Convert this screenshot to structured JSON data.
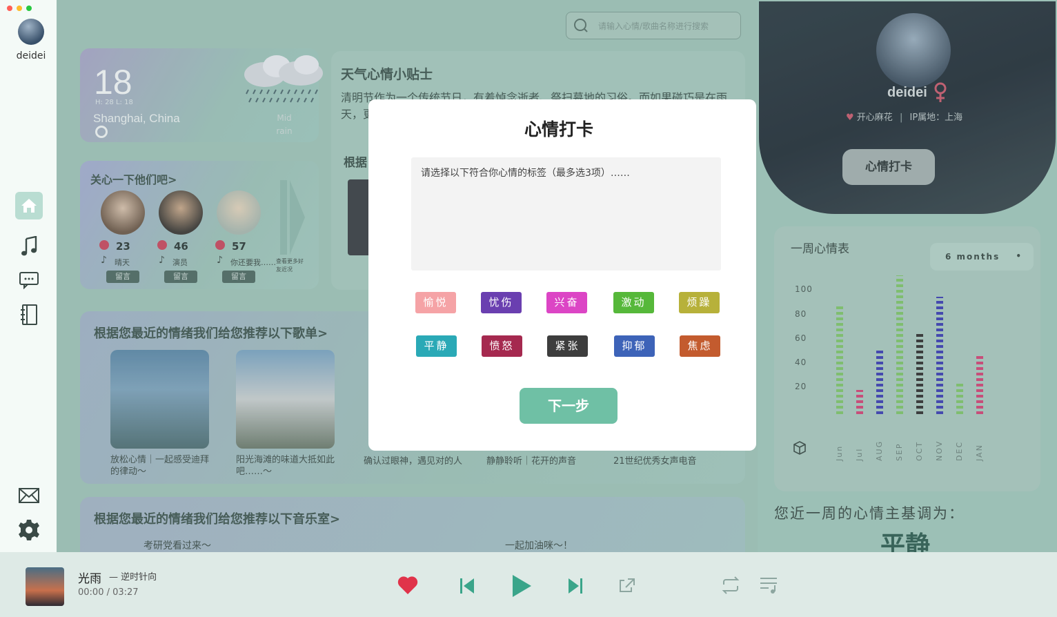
{
  "window": {
    "dot_colors": [
      "#ff5f57",
      "#febc2e",
      "#28c840"
    ]
  },
  "sidebar": {
    "username": "deidei",
    "nav": [
      "home-icon",
      "music-icon",
      "chat-icon",
      "notebook-icon",
      "mail-icon",
      "gear-icon"
    ]
  },
  "search": {
    "placeholder": "请输入心情/歌曲名称进行搜索"
  },
  "weather": {
    "temp": "18",
    "high_low": "H: 28   L: 18",
    "city": "Shanghai, China",
    "desc": "Mid rain"
  },
  "tips": {
    "title": "天气心情小贴士",
    "text": "清明节作为一个传统节日，有着悼念逝者、祭扫墓地的习俗。而如果碰巧是在雨天，更……奏、抒……",
    "sub": "根据"
  },
  "friends": {
    "title": "关心一下他们吧>",
    "items": [
      {
        "count": "23",
        "song": "晴天",
        "msg": "留言"
      },
      {
        "count": "46",
        "song": "演员",
        "msg": "留言"
      },
      {
        "count": "57",
        "song": "你还要我……",
        "msg": "留言"
      }
    ],
    "more": "查看更多好友近况"
  },
  "playlists": {
    "title": "根据您最近的情绪我们给您推荐以下歌单>",
    "items": [
      {
        "caption": "放松心情｜一起感受迪拜的律动～"
      },
      {
        "caption": "阳光海滩的味道大抵如此吧……～"
      },
      {
        "caption": "确认过眼神，遇见对的人"
      },
      {
        "caption": "静静聆听｜花开的声音"
      },
      {
        "caption": "21世纪优秀女声电音"
      }
    ]
  },
  "rooms": {
    "title": "根据您最近的情绪我们给您推荐以下音乐室>",
    "items": [
      "考研党看过来～",
      "一起加油咪～！"
    ]
  },
  "profile": {
    "name": "deidei",
    "gender_icon": "female-icon",
    "tag": "开心麻花",
    "location": "IP属地：上海",
    "checkin": "心情打卡"
  },
  "weekly": {
    "title": "一周心情表",
    "range": "6 months",
    "summary": "您近一周的心情主基调为：",
    "result": "平静"
  },
  "chart_data": {
    "type": "bar",
    "title": "一周心情表",
    "categories": [
      "Jun",
      "Jul",
      "AUG",
      "SEP",
      "OCT",
      "NOV",
      "DEC",
      "JAN"
    ],
    "series": [
      {
        "values": [
          90,
          20,
          55,
          115,
          67,
          97,
          27,
          50
        ]
      }
    ],
    "colors": [
      "#7fc46a",
      "#d14577",
      "#3d3fb3",
      "#7fc46a",
      "#333333",
      "#3d3fb3",
      "#7fc46a",
      "#d14577"
    ],
    "y_ticks": [
      "100",
      "80",
      "60",
      "40",
      "20"
    ],
    "ylim": [
      0,
      115
    ]
  },
  "player": {
    "title": "光雨",
    "artist": "— 逆时针向",
    "time": "00:00 / 03:27"
  },
  "modal": {
    "title": "心情打卡",
    "prompt": "请选择以下符合你心情的标签（最多选3项）……",
    "tags": [
      {
        "label": "愉悦",
        "color": "#f5a3a6"
      },
      {
        "label": "忧伤",
        "color": "#6a3fb0"
      },
      {
        "label": "兴奋",
        "color": "#dc45c5"
      },
      {
        "label": "激动",
        "color": "#56b83a"
      },
      {
        "label": "烦躁",
        "color": "#b7b13a"
      },
      {
        "label": "平静",
        "color": "#2aa9b6"
      },
      {
        "label": "愤怒",
        "color": "#a5294f"
      },
      {
        "label": "紧张",
        "color": "#3d3d3d"
      },
      {
        "label": "抑郁",
        "color": "#3d63b8"
      },
      {
        "label": "焦虑",
        "color": "#c35b2e"
      }
    ],
    "next": "下一步"
  }
}
